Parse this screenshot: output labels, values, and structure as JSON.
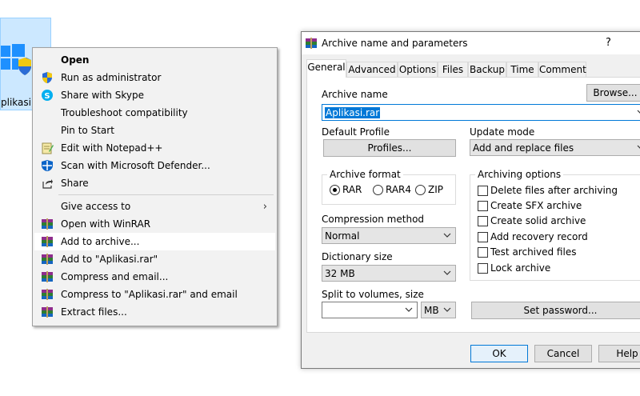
{
  "desktop": {
    "icon_label": "plikasi"
  },
  "context_menu": {
    "items": [
      {
        "label": "Open",
        "icon": "none"
      },
      {
        "label": "Run as administrator",
        "icon": "uac-shield-icon"
      },
      {
        "label": "Share with Skype",
        "icon": "skype-icon"
      },
      {
        "label": "Troubleshoot compatibility",
        "icon": "none"
      },
      {
        "label": "Pin to Start",
        "icon": "none"
      },
      {
        "label": "Edit with Notepad++",
        "icon": "notepadpp-icon"
      },
      {
        "label": "Scan with Microsoft Defender...",
        "icon": "defender-icon"
      },
      {
        "label": "Share",
        "icon": "share-icon"
      },
      {
        "label": "Give access to",
        "icon": "none"
      },
      {
        "label": "Open with WinRAR",
        "icon": "winrar-icon"
      },
      {
        "label": "Add to archive...",
        "icon": "winrar-icon"
      },
      {
        "label": "Add to \"Aplikasi.rar\"",
        "icon": "winrar-icon"
      },
      {
        "label": "Compress and email...",
        "icon": "winrar-icon"
      },
      {
        "label": "Compress to \"Aplikasi.rar\" and email",
        "icon": "winrar-icon"
      },
      {
        "label": "Extract files...",
        "icon": "winrar-icon"
      }
    ],
    "submenu_arrow": "›"
  },
  "dialog": {
    "title": "Archive name and parameters",
    "help": "?",
    "tabs": [
      "General",
      "Advanced",
      "Options",
      "Files",
      "Backup",
      "Time",
      "Comment"
    ],
    "archive_name_label": "Archive name",
    "archive_name_value": "Aplikasi.rar",
    "browse_button": "Browse...",
    "default_profile_label": "Default Profile",
    "profiles_button": "Profiles...",
    "update_mode_label": "Update mode",
    "update_mode_value": "Add and replace files",
    "archive_format_label": "Archive format",
    "formats": [
      "RAR",
      "RAR4",
      "ZIP"
    ],
    "selected_format": "RAR",
    "compression_method_label": "Compression method",
    "compression_method_value": "Normal",
    "dictionary_size_label": "Dictionary size",
    "dictionary_size_value": "32 MB",
    "split_label": "Split to volumes, size",
    "split_value": "",
    "split_unit": "MB",
    "archiving_options_label": "Archiving options",
    "archiving_options": [
      "Delete files after archiving",
      "Create SFX archive",
      "Create solid archive",
      "Add recovery record",
      "Test archived files",
      "Lock archive"
    ],
    "set_password_button": "Set password...",
    "ok_button": "OK",
    "cancel_button": "Cancel",
    "help_button": "Help"
  },
  "colors": {
    "selection": "#0078d7",
    "desktop_icon_bg": "#cce8ff"
  }
}
